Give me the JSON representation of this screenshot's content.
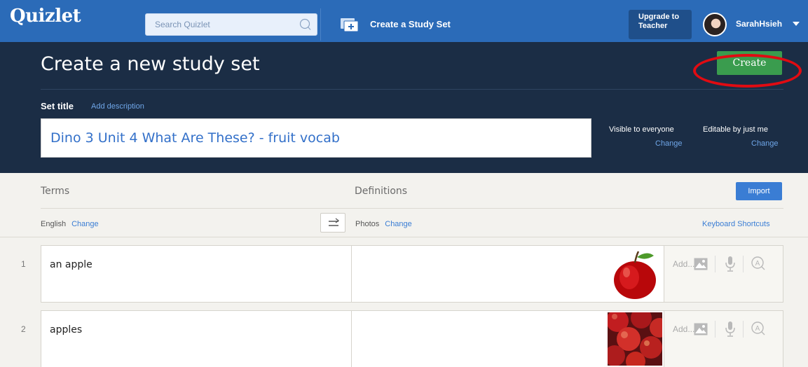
{
  "nav": {
    "logo": "Quizlet",
    "search_placeholder": "Search Quizlet",
    "create_label": "Create a Study Set",
    "upgrade_line1": "Upgrade to",
    "upgrade_line2": "Teacher",
    "username": "SarahHsieh"
  },
  "header": {
    "title": "Create a new study set",
    "create_button": "Create",
    "set_title_label": "Set title",
    "add_description": "Add description",
    "set_title_value": "Dino 3 Unit 4 What Are These? - fruit vocab",
    "visibility_label": "Visible to everyone",
    "visibility_change": "Change",
    "edit_label": "Editable by just me",
    "edit_change": "Change"
  },
  "columns": {
    "terms": "Terms",
    "definitions": "Definitions",
    "import_button": "Import",
    "term_language": "English",
    "term_language_change": "Change",
    "def_language": "Photos",
    "def_language_change": "Change",
    "keyboard_shortcuts": "Keyboard Shortcuts"
  },
  "cards": [
    {
      "number": "1",
      "term": "an apple",
      "definition": "",
      "photo": "single red apple",
      "add_label": "Add..."
    },
    {
      "number": "2",
      "term": "apples",
      "definition": "",
      "photo": "pile of red apples",
      "add_label": "Add..."
    }
  ],
  "colors": {
    "nav_blue": "#2b6bb8",
    "header_navy": "#1b2d45",
    "create_green": "#3a9c4e",
    "highlight_red": "#e10b12",
    "link_blue": "#3a7dd4"
  }
}
